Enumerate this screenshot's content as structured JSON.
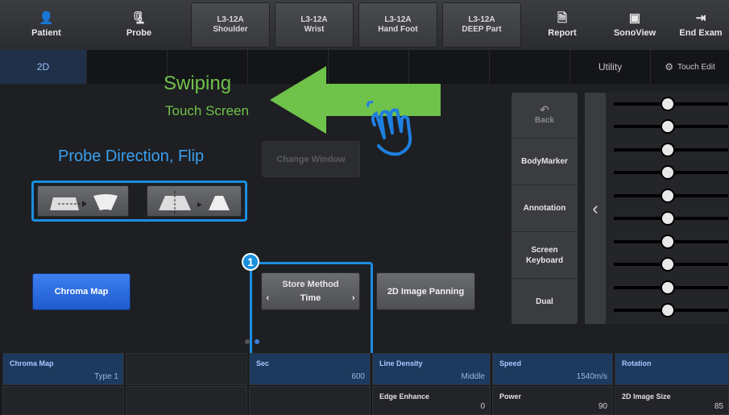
{
  "topbar": {
    "patient": "Patient",
    "probe": "Probe",
    "presets": [
      {
        "line1": "L3-12A",
        "line2": "Shoulder"
      },
      {
        "line1": "L3-12A",
        "line2": "Wrist"
      },
      {
        "line1": "L3-12A",
        "line2": "Hand Foot"
      },
      {
        "line1": "L3-12A",
        "line2": "DEEP Part"
      }
    ],
    "report": "Report",
    "sonoview": "SonoView",
    "end_exam": "End Exam"
  },
  "tabs": {
    "active": "2D",
    "utility": "Utility",
    "touch_edit": "Touch Edit"
  },
  "annotations": {
    "swiping": "Swiping",
    "touch_screen": "Touch Screen",
    "probe_direction": "Probe Direction, Flip",
    "callout_number": "1"
  },
  "main": {
    "change_window": "Change Window",
    "chroma_map": "Chroma Map",
    "store_method_label": "Store Method",
    "store_method_value": "Time",
    "image_panning": "2D Image Panning"
  },
  "side_panel": {
    "back": "Back",
    "body_marker": "BodyMarker",
    "annotation": "Annotation",
    "screen_keyboard_1": "Screen",
    "screen_keyboard_2": "Keyboard",
    "dual": "Dual"
  },
  "bottom": {
    "chroma_map": {
      "label": "Chroma Map",
      "value": "Type 1"
    },
    "sec": {
      "label": "Sec",
      "value": "600"
    },
    "line_density": {
      "label": "Line Density",
      "value": "Middle"
    },
    "speed": {
      "label": "Speed",
      "value": "1540m/s"
    },
    "rotation": {
      "label": "Rotation"
    },
    "edge_enhance": {
      "label": "Edge Enhance",
      "value": "0"
    },
    "power": {
      "label": "Power",
      "value": "90"
    },
    "image_size": {
      "label": "2D Image Size",
      "value": "85"
    }
  },
  "colors": {
    "accent_blue": "#1e5bd0",
    "callout_blue": "#1a8fe0",
    "arrow_green": "#6fc24a"
  },
  "icons": [
    "patient-icon",
    "probe-icon",
    "report-icon",
    "sonoview-icon",
    "end-exam-icon",
    "touch-edit-icon",
    "back-icon",
    "chevron-left-icon",
    "chevron-right-icon",
    "swipe-hand-icon",
    "swipe-arrow-icon"
  ]
}
